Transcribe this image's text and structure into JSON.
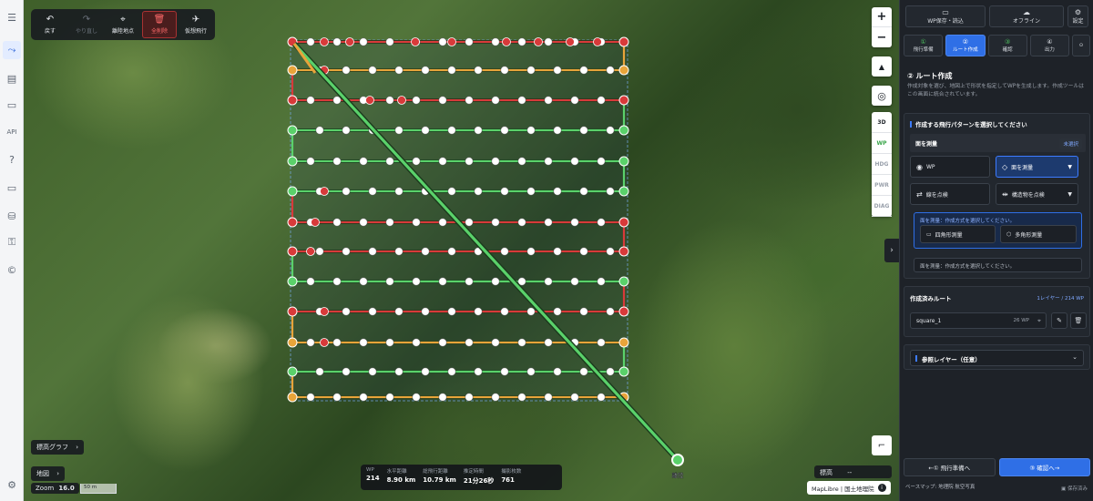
{
  "rail": {
    "items": [
      {
        "icon": "menu-icon",
        "glyph": "☰"
      },
      {
        "icon": "route-icon",
        "glyph": "⤳",
        "active": true
      },
      {
        "icon": "document-icon",
        "glyph": "▤"
      },
      {
        "icon": "storage-icon",
        "glyph": "▭"
      },
      {
        "icon": "api-icon",
        "glyph": "API"
      },
      {
        "icon": "help-icon",
        "glyph": "?"
      },
      {
        "icon": "monitor-icon",
        "glyph": "▭"
      },
      {
        "icon": "database-settings-icon",
        "glyph": "⛁"
      },
      {
        "icon": "key-icon",
        "glyph": "⚿"
      },
      {
        "icon": "copyright-icon",
        "glyph": "©"
      },
      {
        "icon": "settings-icon",
        "glyph": "⚙"
      }
    ]
  },
  "toolbar": {
    "undo": "戻す",
    "redo": "やり直し",
    "takeoff_point": "離陸地点",
    "delete_all": "全削除",
    "virtual_flight": "仮想飛行"
  },
  "map_controls": {
    "zoom_in": "+",
    "zoom_out": "−",
    "compass": "▲",
    "locate": "◎",
    "layers": [
      "3D",
      "WP",
      "HDG",
      "PWR",
      "DIAG"
    ],
    "collapse": "›",
    "draw": "⌐"
  },
  "map_labels": {
    "elevation_graph": "標高グラフ",
    "map": "地図",
    "zoom_label": "Zoom",
    "zoom_value": "16.0",
    "scale": "50 m",
    "takeoff": "離陸",
    "elevation": "標高",
    "elevation_value": "--",
    "attribution": "MapLibre | 国土地理院"
  },
  "stats": [
    {
      "label": "WP",
      "value": "214"
    },
    {
      "label": "水平距離",
      "value": "8.90 km"
    },
    {
      "label": "総飛行距離",
      "value": "10.79 km"
    },
    {
      "label": "推定時間",
      "value": "21分26秒"
    },
    {
      "label": "撮影枚数",
      "value": "761"
    }
  ],
  "panel": {
    "save_load": "WP保存・読込",
    "offline": "オフライン",
    "settings": "設定",
    "steps": [
      {
        "num": "①",
        "label": "飛行準備",
        "state": "done"
      },
      {
        "num": "②",
        "label": "ルート作成",
        "state": "active"
      },
      {
        "num": "③",
        "label": "確認",
        "state": "done"
      },
      {
        "num": "④",
        "label": "出力",
        "state": "todo"
      }
    ],
    "section_title": "② ルート作成",
    "section_desc": "作成対象を選び、地図上で形状を指定してWPを生成します。作成ツールはこの画面に統合されています。",
    "pattern_title": "作成する飛行パターンを選択してください",
    "area_survey": "面を測量",
    "unselected": "未選択",
    "options": [
      {
        "label": "WP",
        "glyph": "◉"
      },
      {
        "label": "面を測量",
        "glyph": "◇",
        "selected": true
      },
      {
        "label": "線を点検",
        "glyph": "⇄"
      },
      {
        "label": "構造物を点検",
        "glyph": "⇹"
      }
    ],
    "method_prompt": "面を測量：作成方式を選択してください。",
    "rect_survey": "四角形測量",
    "poly_survey": "多角形測量",
    "method_note": "面を測量：作成方式を選択してください。",
    "created_routes": "作成済みルート",
    "routes_summary": "1レイヤー / 214 WP",
    "route_name": "square_1",
    "route_wp": "26 WP",
    "ref_layers": "参照レイヤー（任意）",
    "back_btn": "←① 飛行準備へ",
    "next_btn": "③ 確認へ→",
    "basemap": "ベースマップ: 地理院 航空写真",
    "saved": "保存済み"
  }
}
